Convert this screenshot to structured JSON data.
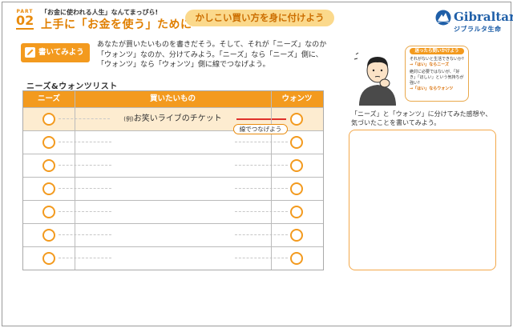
{
  "header": {
    "part_label": "PART",
    "part_number": "02",
    "subtitle": "「お金に使われる人生」なんてまっぴら!",
    "title": "上手に「お金を使う」ために",
    "pill": "かしこい買い方を身に付けよう",
    "logo_name": "Gibraltar",
    "logo_sub": "ジブラルタ生命"
  },
  "task": {
    "badge": "書いてみよう",
    "instruction_1": "あなたが買いたいものを書きだそう。そして、それが「ニーズ」なのか",
    "instruction_2": "「ウォンツ」なのか、分けてみよう。「ニーズ」なら「ニーズ」側に、",
    "instruction_3": "「ウォンツ」なら「ウォンツ」側に線でつなげよう。"
  },
  "list": {
    "title": "ニーズ&ウォンツリスト",
    "headers": [
      "ニーズ",
      "買いたいもの",
      "ウォンツ"
    ],
    "example_prefix": "(例)",
    "example_item": "お笑いライブのチケット",
    "connect_tag": "線でつなげよう",
    "empty_rows": 6
  },
  "helper": {
    "title": "迷ったら問いかけよう",
    "q1": "それがないと生活できないか?",
    "a1_prefix": "→",
    "a1": "「はい」ならニーズ",
    "q2": "絶対に必要ではないが、「好き」「ほしい」という気持ちが強い?",
    "a2_prefix": "→",
    "a2": "「はい」ならウォンツ"
  },
  "reflection": {
    "line_1": "「ニーズ」と「ウォンツ」に分けてみた感想や、",
    "line_2": "気づいたことを書いてみよう。"
  },
  "colors": {
    "accent": "#f39a1e",
    "title_orange": "#e07f00",
    "pill_bg": "#fbd98c",
    "brand_blue": "#1f5fa8",
    "connect_line": "#e0312b"
  }
}
